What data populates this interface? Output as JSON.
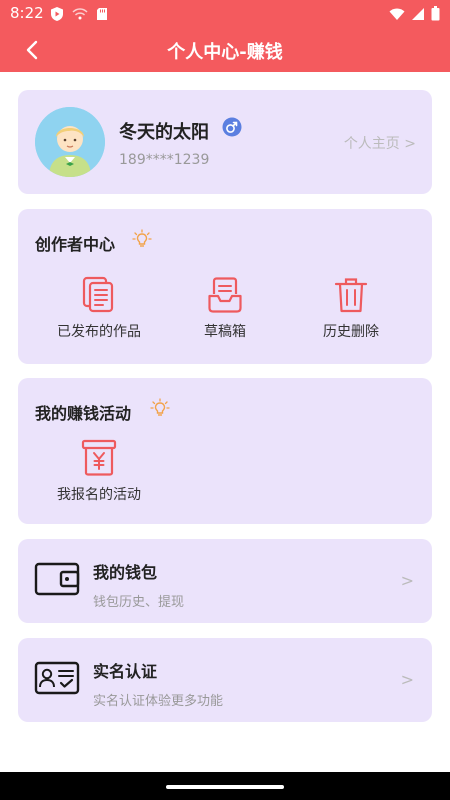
{
  "status_bar": {
    "time": "8:22"
  },
  "app_bar": {
    "title": "个人中心-赚钱"
  },
  "profile": {
    "name": "冬天的太阳",
    "phone": "189****1239",
    "homepage_link": "个人主页 >"
  },
  "creator_center": {
    "title": "创作者中心",
    "items": [
      {
        "label": "已发布的作品",
        "icon": "documents-icon"
      },
      {
        "label": "草稿箱",
        "icon": "draft-box-icon"
      },
      {
        "label": "历史删除",
        "icon": "trash-icon"
      }
    ]
  },
  "earning": {
    "title": "我的赚钱活动",
    "items": [
      {
        "label": "我报名的活动",
        "icon": "yuan-box-icon"
      }
    ]
  },
  "wallet": {
    "title": "我的钱包",
    "subtitle": "钱包历史、提现",
    "chevron": ">"
  },
  "verification": {
    "title": "实名认证",
    "subtitle": "实名认证体验更多功能",
    "chevron": ">"
  },
  "colors": {
    "accent": "#f45a5e",
    "card_bg": "#ebe3fb",
    "icon_red": "#ee5a5e",
    "bulb": "#f2a34a",
    "gender_blue": "#5b7fe0"
  }
}
